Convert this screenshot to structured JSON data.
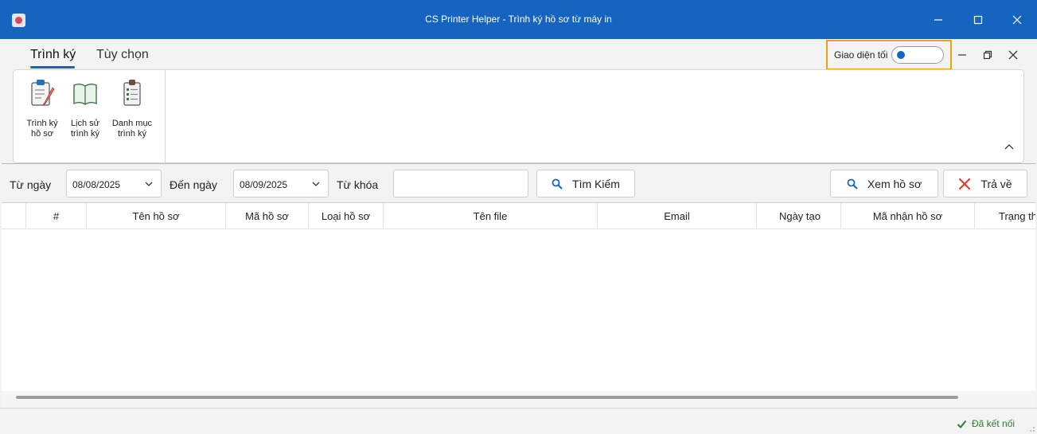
{
  "window": {
    "title": "CS Printer Helper - Trình ký hồ sơ từ máy in"
  },
  "ribbon": {
    "tabs": [
      {
        "label": "Trình ký",
        "active": true
      },
      {
        "label": "Tùy chọn",
        "active": false
      }
    ],
    "dark_mode": {
      "label": "Giao diện tối",
      "enabled": false
    },
    "buttons": [
      {
        "line1": "Trình ký",
        "line2": "hồ sơ",
        "icon": "clipboard-pen-icon"
      },
      {
        "line1": "Lịch sử",
        "line2": "trình ký",
        "icon": "open-book-icon"
      },
      {
        "line1": "Danh mục",
        "line2": "trình ký",
        "icon": "checklist-icon"
      }
    ]
  },
  "search": {
    "from_label": "Từ ngày",
    "from_value": "08/08/2025",
    "to_label": "Đến ngày",
    "to_value": "08/09/2025",
    "keyword_label": "Từ khóa",
    "keyword_value": "",
    "search_button": "Tìm Kiếm",
    "view_button": "Xem hồ sơ",
    "return_button": "Trả về"
  },
  "grid": {
    "columns": [
      "#",
      "Tên hồ sơ",
      "Mã hồ sơ",
      "Loại hồ sơ",
      "Tên file",
      "Email",
      "Ngày tạo",
      "Mã nhận hồ sơ",
      "Trạng thái"
    ],
    "rows": []
  },
  "status": {
    "text": "Đã kết nối"
  },
  "colors": {
    "titlebar": "#1565c0",
    "toggle_highlight": "#f0a30a",
    "status_ok": "#2e7d32",
    "return_icon": "#e53935"
  }
}
